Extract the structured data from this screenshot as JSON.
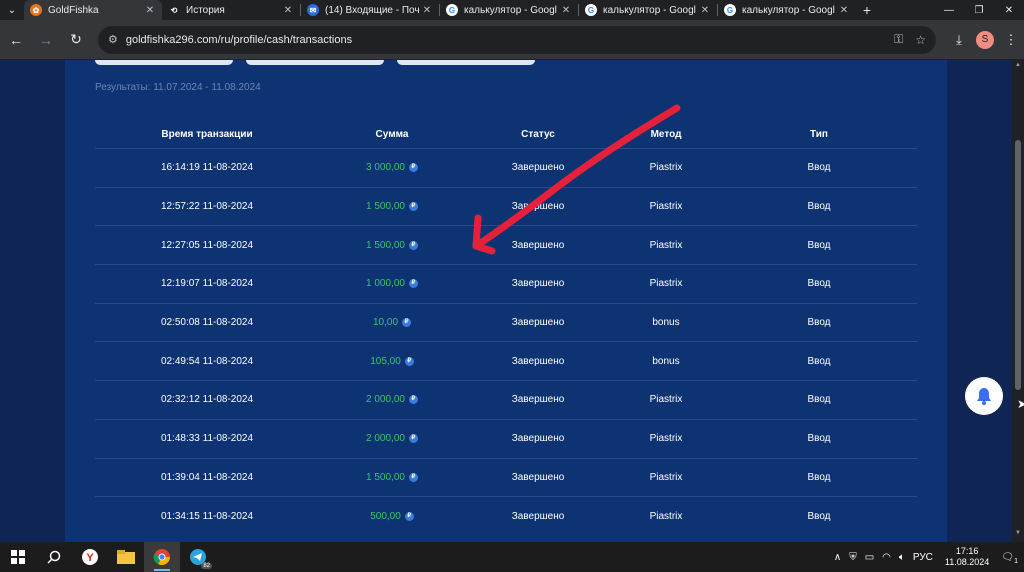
{
  "browser": {
    "tabs": [
      {
        "title": "GoldFishka",
        "favicon": "goldfishka-icon",
        "active": true
      },
      {
        "title": "История",
        "favicon": "history-icon",
        "active": false
      },
      {
        "title": "(14) Входящие - Поч",
        "favicon": "mail-icon",
        "active": false
      },
      {
        "title": "калькулятор - Googl",
        "favicon": "google-icon",
        "active": false
      },
      {
        "title": "калькулятор - Googl",
        "favicon": "google-icon",
        "active": false
      },
      {
        "title": "калькулятор - Googl",
        "favicon": "google-icon",
        "active": false
      }
    ],
    "url": "goldfishka296.com/ru/profile/cash/transactions",
    "profile_initial": "S"
  },
  "page": {
    "results_text": "Результаты: 11.07.2024 - 11.08.2024",
    "columns": [
      "Время транзакции",
      "Сумма",
      "Статус",
      "Метод",
      "Тип"
    ],
    "currency_symbol": "₽",
    "transactions": [
      {
        "time": "16:14:19 11-08-2024",
        "amount": "3 000,00",
        "status": "Завершено",
        "method": "Piastrix",
        "type": "Ввод"
      },
      {
        "time": "12:57:22 11-08-2024",
        "amount": "1 500,00",
        "status": "Завершено",
        "method": "Piastrix",
        "type": "Ввод"
      },
      {
        "time": "12:27:05 11-08-2024",
        "amount": "1 500,00",
        "status": "Завершено",
        "method": "Piastrix",
        "type": "Ввод"
      },
      {
        "time": "12:19:07 11-08-2024",
        "amount": "1 000,00",
        "status": "Завершено",
        "method": "Piastrix",
        "type": "Ввод"
      },
      {
        "time": "02:50:08 11-08-2024",
        "amount": "10,00",
        "status": "Завершено",
        "method": "bonus",
        "type": "Ввод"
      },
      {
        "time": "02:49:54 11-08-2024",
        "amount": "105,00",
        "status": "Завершено",
        "method": "bonus",
        "type": "Ввод"
      },
      {
        "time": "02:32:12 11-08-2024",
        "amount": "2 000,00",
        "status": "Завершено",
        "method": "Piastrix",
        "type": "Ввод"
      },
      {
        "time": "01:48:33 11-08-2024",
        "amount": "2 000,00",
        "status": "Завершено",
        "method": "Piastrix",
        "type": "Ввод"
      },
      {
        "time": "01:39:04 11-08-2024",
        "amount": "1 500,00",
        "status": "Завершено",
        "method": "Piastrix",
        "type": "Ввод"
      },
      {
        "time": "01:34:15 11-08-2024",
        "amount": "500,00",
        "status": "Завершено",
        "method": "Piastrix",
        "type": "Ввод"
      }
    ]
  },
  "taskbar": {
    "apps": [
      "windows-start-icon",
      "search-icon",
      "yandex-browser-icon",
      "file-explorer-icon",
      "chrome-icon",
      "telegram-icon"
    ],
    "telegram_badge": "82",
    "language": "РУС",
    "time": "17:16",
    "date": "11.08.2024",
    "notifications_count": "1"
  },
  "colors": {
    "page_bg": "#0f2553",
    "panel_bg": "#0e3373",
    "amount_green": "#3cc26b",
    "annotation_red": "#e5213a"
  }
}
